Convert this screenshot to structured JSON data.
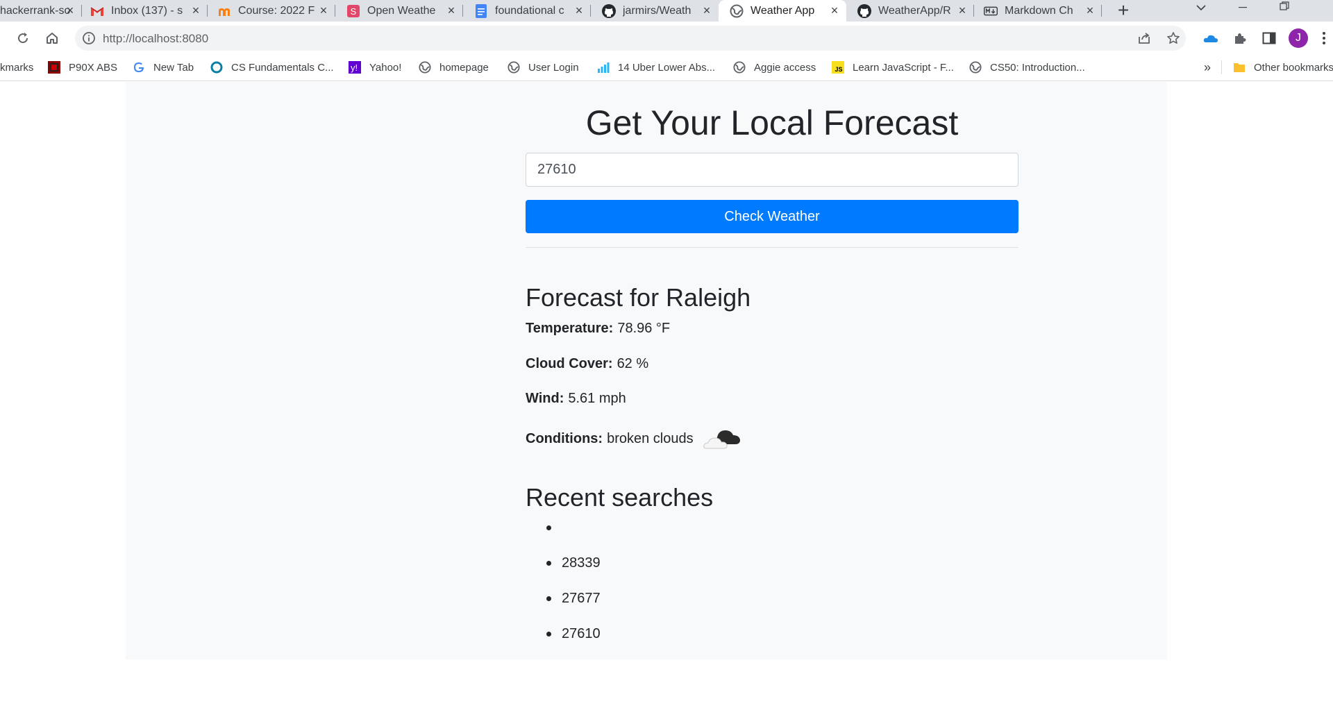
{
  "browser": {
    "tabs": [
      {
        "title": "hackerrank-so",
        "icon": "hackerrank-favicon"
      },
      {
        "title": "Inbox (137) - s",
        "icon": "gmail-icon"
      },
      {
        "title": "Course: 2022 F",
        "icon": "moodle-icon"
      },
      {
        "title": "Open Weathe",
        "icon": "s-favicon"
      },
      {
        "title": "foundational c",
        "icon": "docs-icon"
      },
      {
        "title": "jarmirs/Weath",
        "icon": "github-icon"
      },
      {
        "title": "Weather App",
        "icon": "globe-icon",
        "active": true
      },
      {
        "title": "WeatherApp/R",
        "icon": "github-icon"
      },
      {
        "title": "Markdown Ch",
        "icon": "markdown-icon"
      }
    ],
    "url": "http://localhost:8080",
    "avatar_letter": "J",
    "bookmarks": [
      {
        "label": "kmarks",
        "icon": "none"
      },
      {
        "label": "P90X ABS",
        "icon": "p90x-icon"
      },
      {
        "label": "New Tab",
        "icon": "google-icon"
      },
      {
        "label": "CS Fundamentals C...",
        "icon": "circle-icon"
      },
      {
        "label": "Yahoo!",
        "icon": "yahoo-icon"
      },
      {
        "label": "homepage",
        "icon": "globe-icon"
      },
      {
        "label": "User Login",
        "icon": "globe-icon"
      },
      {
        "label": "14 Uber Lower Abs...",
        "icon": "bars-icon"
      },
      {
        "label": "Aggie access",
        "icon": "globe-icon"
      },
      {
        "label": "Learn JavaScript - F...",
        "icon": "js-icon"
      },
      {
        "label": "CS50: Introduction...",
        "icon": "globe-icon"
      }
    ],
    "more_bookmarks": "»",
    "other_bookmarks": "Other bookmarks"
  },
  "page": {
    "title": "Get Your Local Forecast",
    "zip_value": "27610",
    "check_button": "Check Weather",
    "forecast_heading": "Forecast for Raleigh",
    "temperature_label": "Temperature:",
    "temperature_value": "78.96 °F",
    "cloud_label": "Cloud Cover:",
    "cloud_value": "62 %",
    "wind_label": "Wind:",
    "wind_value": "5.61 mph",
    "conditions_label": "Conditions:",
    "conditions_value": "broken clouds",
    "conditions_icon": "broken-clouds-icon",
    "recent_heading": "Recent searches",
    "recent_searches": [
      "",
      "28339",
      "27677",
      "27610"
    ]
  },
  "colors": {
    "primary_button": "#007bff",
    "panel_background": "#f8f9fa",
    "active_tab": "#ffffff",
    "tabstrip": "#dee1e6"
  }
}
